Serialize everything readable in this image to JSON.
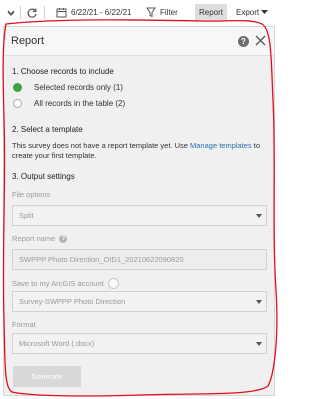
{
  "toolbar": {
    "date_range": "6/22/21 - 6/22/21",
    "filter_label": "Filter",
    "report_label": "Report",
    "export_label": "Export"
  },
  "panel": {
    "title": "Report",
    "section1": {
      "heading": "1. Choose records to include",
      "options": [
        {
          "label": "Selected records only (1)",
          "checked": true
        },
        {
          "label": "All records in the table (2)",
          "checked": false
        }
      ]
    },
    "section2": {
      "heading": "2. Select a template",
      "text_before": "This survey does not have a report template yet. Use ",
      "link": "Manage templates",
      "text_after": " to create your first template."
    },
    "section3": {
      "heading": "3. Output settings",
      "file_options_label": "File options",
      "file_options_value": "Split",
      "report_name_label": "Report name",
      "report_name_value": "SWPPP Photo Direction_OID1_20210622090820",
      "save_label": "Save to my ArcGIS account",
      "save_value": "Survey-SWPPP Photo Direction",
      "format_label": "Format",
      "format_value": "Microsoft Word (.docx)"
    },
    "generate_label": "Generate"
  },
  "colors": {
    "accent_green": "#3ea33e",
    "link_blue": "#2e6fb3",
    "annotation_red": "#e0101a"
  }
}
